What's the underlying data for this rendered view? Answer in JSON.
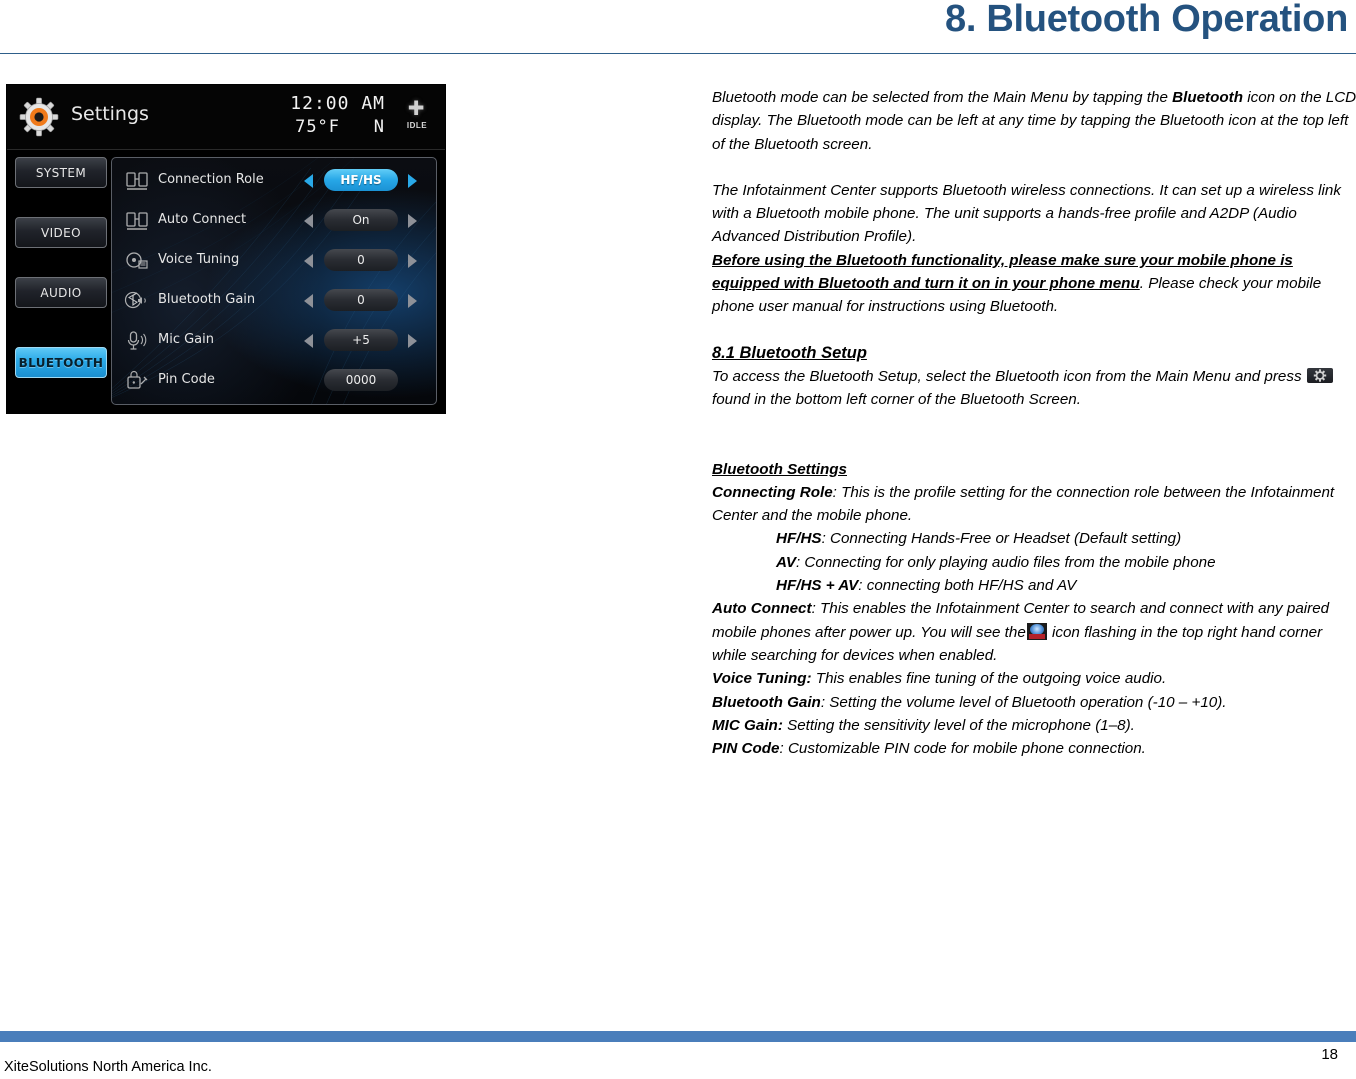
{
  "header": {
    "title": "8. Bluetooth Operation",
    "title_color": "#24527F",
    "rule_color": "#2E5F8A"
  },
  "device_screenshot": {
    "status_bar": {
      "app_title": "Settings",
      "gear_icon": "settings-gear-icon",
      "clock": "12:00 AM",
      "temperature": "75°F",
      "gear_position": "N",
      "bluetooth_status_icon": "bluetooth-icon",
      "bluetooth_status_label": "IDLE"
    },
    "side_buttons": [
      {
        "label": "SYSTEM",
        "active": false
      },
      {
        "label": "VIDEO",
        "active": false
      },
      {
        "label": "AUDIO",
        "active": false
      },
      {
        "label": "BLUETOOTH",
        "active": true
      }
    ],
    "settings_rows": [
      {
        "icon": "connection-role-icon",
        "label": "Connection Role",
        "value": "HF/HS",
        "selected": true,
        "has_arrows": true
      },
      {
        "icon": "auto-connect-icon",
        "label": "Auto Connect",
        "value": "On",
        "selected": false,
        "has_arrows": true
      },
      {
        "icon": "voice-tuning-icon",
        "label": "Voice Tuning",
        "value": "0",
        "selected": false,
        "has_arrows": true
      },
      {
        "icon": "bluetooth-gain-icon",
        "label": "Bluetooth Gain",
        "value": "0",
        "selected": false,
        "has_arrows": true
      },
      {
        "icon": "mic-gain-icon",
        "label": "Mic Gain",
        "value": "+5",
        "selected": false,
        "has_arrows": true
      },
      {
        "icon": "pin-code-icon",
        "label": "Pin Code",
        "value": "0000",
        "selected": false,
        "has_arrows": false
      }
    ],
    "accent_color": "#29A9E8"
  },
  "body": {
    "para1_a": "Bluetooth mode can be selected from the Main Menu by tapping the ",
    "para1_bold": "Bluetooth",
    "para1_b": " icon on the LCD display. The Bluetooth mode can be left at any time by tapping the Bluetooth icon at the top left of the Bluetooth screen.",
    "para2": "The Infotainment Center supports Bluetooth wireless connections. It can set up a wireless link with a Bluetooth mobile phone. The unit supports a hands-free profile and A2DP (Audio Advanced Distribution Profile).",
    "warning_bold": "Before using the Bluetooth functionality, please make sure your mobile phone is equipped with Bluetooth and turn it on in your phone menu",
    "warning_rest": ". Please check your mobile phone user manual for instructions using Bluetooth.",
    "section_heading": "8.1  Bluetooth Setup",
    "section_text_a": "To access the Bluetooth Setup, select the Bluetooth icon from the Main Menu and press ",
    "section_gear_icon": "gear-button-icon",
    "section_text_b": "found in the bottom left corner of the Bluetooth Screen.",
    "settings_heading": "Bluetooth Settings",
    "connecting_role_label": "Connecting Role",
    "connecting_role_text": ": This is the profile setting for the connection role between the Infotainment Center and the mobile phone.",
    "role_options": [
      {
        "name": "HF/HS",
        "desc": ": Connecting Hands-Free or Headset (Default setting)"
      },
      {
        "name": "AV",
        "desc": ": Connecting for only playing audio files from the mobile phone"
      },
      {
        "name": "HF/HS + AV",
        "desc": ": connecting both HF/HS and AV"
      }
    ],
    "auto_connect_label": "Auto Connect",
    "auto_connect_text_a": ": This enables the Infotainment Center to search and connect with any paired mobile phones after power up. You will see the",
    "auto_connect_icon": "bluetooth-search-icon",
    "auto_connect_text_b": " icon flashing in the top right hand corner while searching for devices when enabled.",
    "voice_tuning_label": "Voice Tuning:",
    "voice_tuning_text": " This enables fine tuning of the outgoing voice audio.",
    "bluetooth_gain_label": "Bluetooth Gain",
    "bluetooth_gain_text": ": Setting the volume level of Bluetooth operation (-10 – +10).",
    "mic_gain_label": "MIC Gain:",
    "mic_gain_text": " Setting the sensitivity level of the microphone   (1–8).",
    "pin_code_label": "PIN Code",
    "pin_code_text": ": Customizable PIN code for mobile phone connection."
  },
  "footer": {
    "company": "XiteSolutions North America Inc.",
    "page_number": "18",
    "bar_color": "#4A7EBB"
  }
}
